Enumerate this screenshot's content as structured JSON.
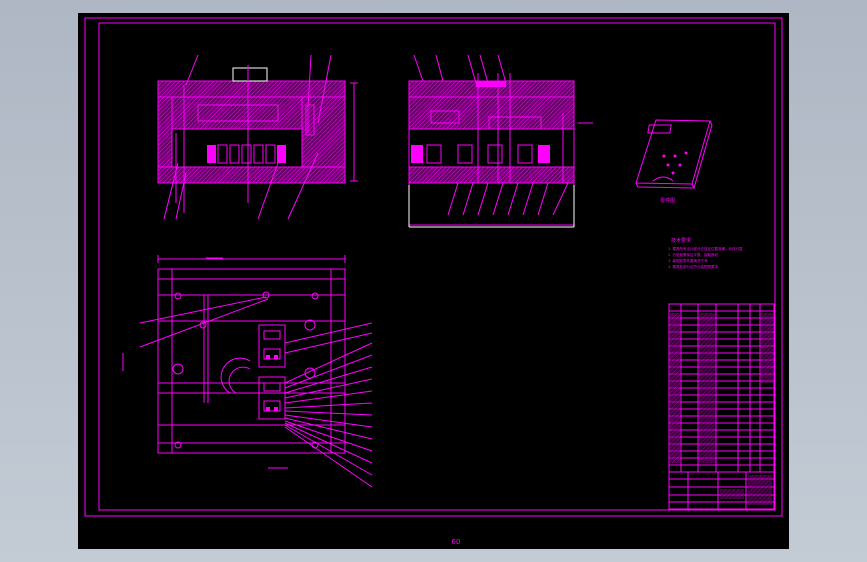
{
  "viewport": {
    "background": "#000000",
    "line_color": "#ff00ff",
    "outline_color": "#ffffff"
  },
  "part_view_label": "零件图",
  "tech_req_title": "技术要求",
  "tech_req_lines": [
    "1. 模具所有活动部分应保证位置准确、动作可靠",
    "2. 分型面要保证平整、接触良好",
    "3. 装配前零件要清洗干净",
    "4. 模具各部分应符合装配图要求"
  ],
  "footer_label": "60",
  "model_space_labels": [
    "A",
    "A",
    "A-A"
  ]
}
